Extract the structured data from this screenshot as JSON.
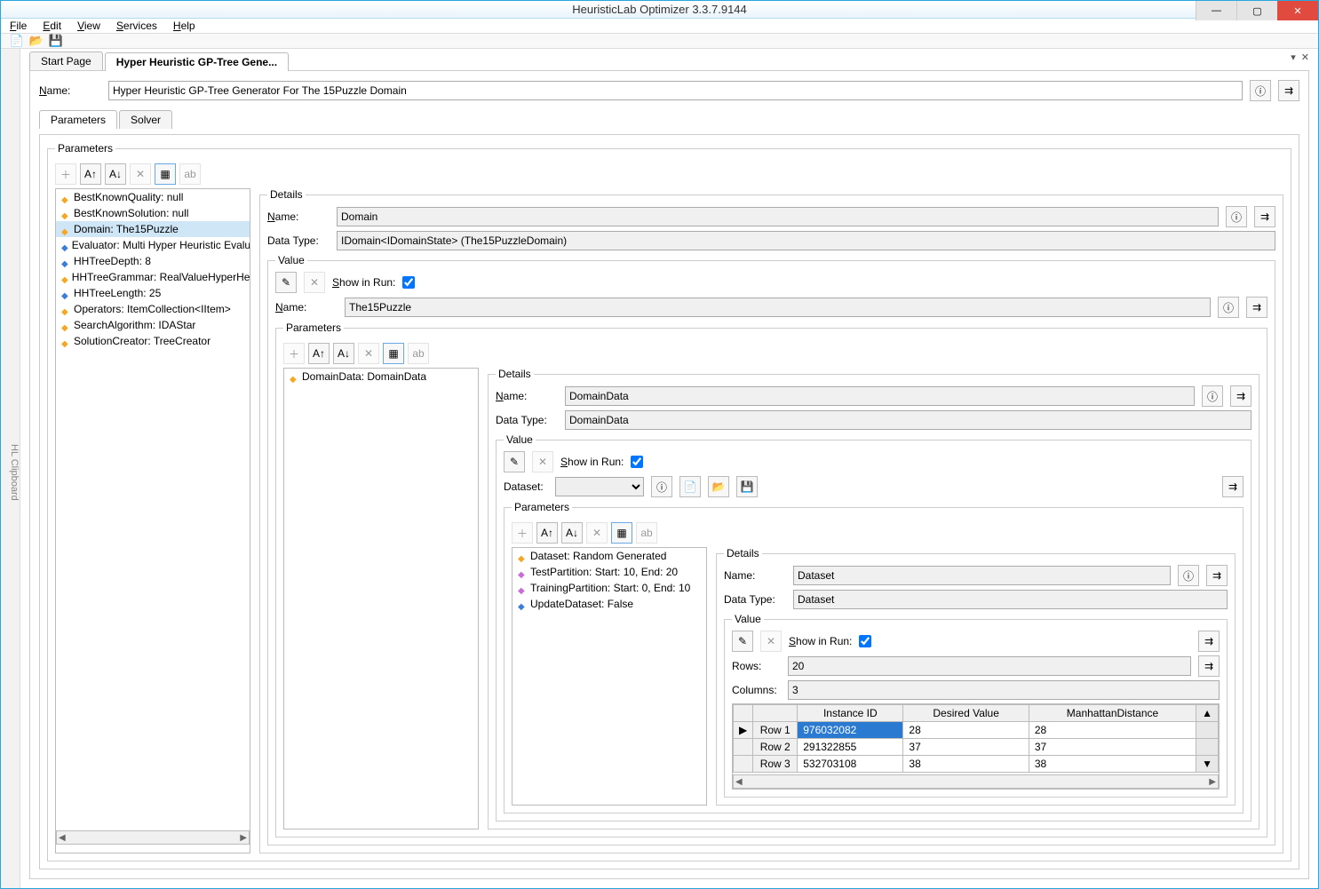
{
  "window": {
    "title": "HeuristicLab Optimizer 3.3.7.9144"
  },
  "menubar": [
    "File",
    "Edit",
    "View",
    "Services",
    "Help"
  ],
  "doc_tabs": {
    "tabs": [
      "Start Page",
      "Hyper Heuristic GP-Tree Gene..."
    ],
    "active": 1
  },
  "name_label": "Name:",
  "name_value": "Hyper Heuristic GP-Tree Generator For The 15Puzzle Domain",
  "sub_tabs": [
    "Parameters",
    "Solver"
  ],
  "params_legend": "Parameters",
  "details_legend": "Details",
  "value_legend": "Value",
  "show_in_run_label": "Show in Run:",
  "label_name": "Name:",
  "label_datatype": "Data Type:",
  "label_dataset": "Dataset:",
  "label_rows": "Rows:",
  "label_cols": "Columns:",
  "param_tree": [
    "BestKnownQuality: null",
    "BestKnownSolution: null",
    "Domain: The15Puzzle",
    "Evaluator: Multi Hyper Heuristic Evaluator",
    "HHTreeDepth: 8",
    "HHTreeGrammar: RealValueHyperHeuristicGrammar",
    "HHTreeLength: 25",
    "Operators: ItemCollection<IItem>",
    "SearchAlgorithm: IDAStar",
    "SolutionCreator: TreeCreator"
  ],
  "param_tree_selected": 2,
  "details1": {
    "name": "Domain",
    "datatype": "IDomain<IDomainState> (The15PuzzleDomain)",
    "value_name": "The15Puzzle"
  },
  "param_tree2": [
    "DomainData: DomainData"
  ],
  "details2": {
    "name": "DomainData",
    "datatype": "DomainData"
  },
  "param_tree3": [
    "Dataset: Random Generated",
    "TestPartition: Start: 10, End: 20",
    "TrainingPartition: Start: 0, End: 10",
    "UpdateDataset: False"
  ],
  "details3": {
    "name": "Dataset",
    "datatype": "Dataset",
    "rows": "20",
    "cols": "3"
  },
  "grid": {
    "cols": [
      "Instance ID",
      "Desired Value",
      "ManhattanDistance"
    ],
    "rowlabels": [
      "Row 1",
      "Row 2",
      "Row 3"
    ],
    "rows": [
      [
        "976032082",
        "28",
        "28"
      ],
      [
        "291322855",
        "37",
        "37"
      ],
      [
        "532703108",
        "38",
        "38"
      ]
    ]
  },
  "clipboard_label": "HL Clipboard"
}
